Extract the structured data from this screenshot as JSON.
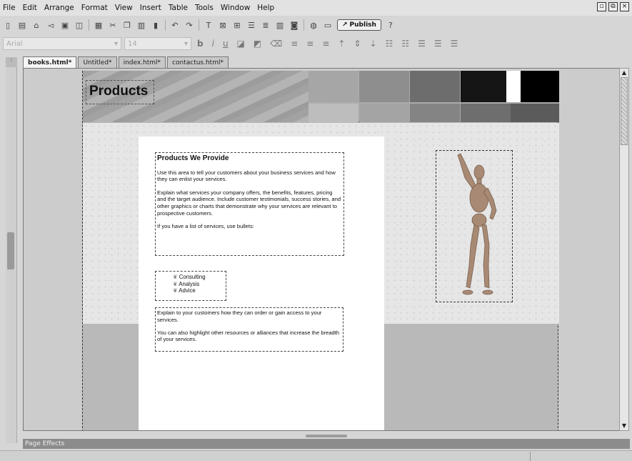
{
  "menu": [
    "File",
    "Edit",
    "Arrange",
    "Format",
    "View",
    "Insert",
    "Table",
    "Tools",
    "Window",
    "Help"
  ],
  "window_controls": [
    "restore-icon",
    "float-icon",
    "close-icon"
  ],
  "toolbar": {
    "icons_group1": [
      "new-icon",
      "open-icon",
      "site-icon",
      "back-icon",
      "save-icon",
      "preview-icon"
    ],
    "icons_group2": [
      "paste-special-icon",
      "cut-icon",
      "copy-icon",
      "paste-icon",
      "delete-icon"
    ],
    "icons_group3": [
      "undo-icon",
      "redo-icon"
    ],
    "icons_group4": [
      "text-icon",
      "image-icon",
      "table-icon",
      "form-icon",
      "list-icon",
      "columns-icon",
      "object-icon"
    ],
    "icons_group5": [
      "globe-icon",
      "frame-icon"
    ],
    "publish_label": "Publish",
    "help_icon": "help-icon"
  },
  "format_bar": {
    "font": "Arial",
    "size": "14",
    "bold": "b",
    "italic": "i",
    "underline": "u"
  },
  "tabs": [
    "books.html*",
    "Untitled*",
    "index.html*",
    "contactus.html*"
  ],
  "page": {
    "banner_title": "Products",
    "swatch_colors_top": [
      "#a6a6a6",
      "#8e8e8e",
      "#6d6d6d",
      "#151515",
      "#ffffff",
      "#000000"
    ],
    "swatch_colors_bottom": [
      "#bdbdbd",
      "#a4a4a4",
      "#848484",
      "#6e6e6e",
      "#5b5b5b"
    ],
    "heading": "Products We Provide",
    "paragraphs": [
      "Use this area to tell your customers about your business services and how they can enlist your services.",
      "Explain what services your company offers, the benefits, features, pricing and the target audience. Include customer testimonials, success stories, and other graphics or charts that demonstrate why your services are relevant to prospective customers.",
      "If you have a list of services, use bullets:"
    ],
    "bullets": [
      "Consulting",
      "Analysis",
      "Advice"
    ],
    "order_paragraphs": [
      "Explain to your customers how they can order or gain access to your services.",
      "You can also highlight other resources or alliances that increase the breadth of your services."
    ]
  },
  "bottom_panel": "Page Effects"
}
